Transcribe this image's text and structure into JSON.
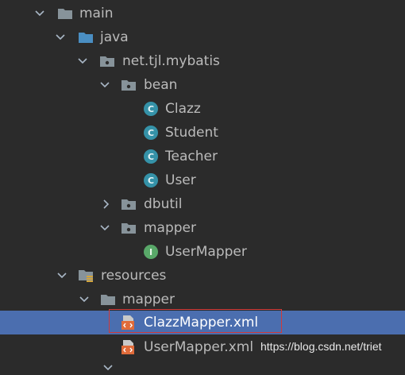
{
  "tree": {
    "main": "main",
    "java": "java",
    "package": "net.tjl.mybatis",
    "bean": "bean",
    "clazz": "Clazz",
    "student": "Student",
    "teacher": "Teacher",
    "user": "User",
    "dbutil": "dbutil",
    "mapper_pkg": "mapper",
    "user_mapper": "UserMapper",
    "resources": "resources",
    "mapper_dir": "mapper",
    "clazz_mapper_xml": "ClazzMapper.xml",
    "user_mapper_xml": "UserMapper.xml"
  },
  "icons": {
    "class_letter": "C",
    "interface_letter": "I"
  },
  "watermark": "https://blog.csdn.net/triet",
  "colors": {
    "background": "#2b2b2b",
    "selection": "#4b6eaf",
    "class_icon": "#3592a8",
    "interface_icon": "#59a869",
    "folder": "#87939a",
    "source_folder": "#4a8ec2",
    "xml_icon": "#e06b3a",
    "highlight_border": "#d03a3a"
  }
}
